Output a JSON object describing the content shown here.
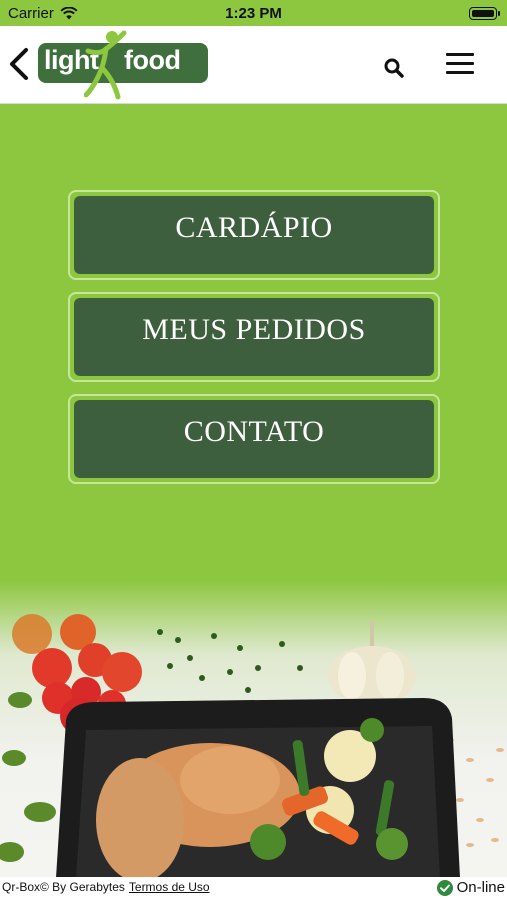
{
  "status_bar": {
    "carrier": "Carrier",
    "time": "1:23 PM"
  },
  "header": {
    "logo_light": "light",
    "logo_food": "food",
    "icons": [
      "back-chevron-icon",
      "search-icon",
      "hamburger-menu-icon"
    ]
  },
  "menu": {
    "items": [
      {
        "label": "CARDÁPIO"
      },
      {
        "label": "MEUS PEDIDOS"
      },
      {
        "label": "CONTATO"
      }
    ]
  },
  "footer": {
    "credit": "Qr-Box© By Gerabytes",
    "terms": "Termos de Uso",
    "status": "On-line"
  },
  "colors": {
    "background": "#8dc63f",
    "button": "#3e5f3e",
    "button_border": "#c6e79a",
    "logo_box": "#3f6f3d",
    "online": "#2e8b3e"
  }
}
